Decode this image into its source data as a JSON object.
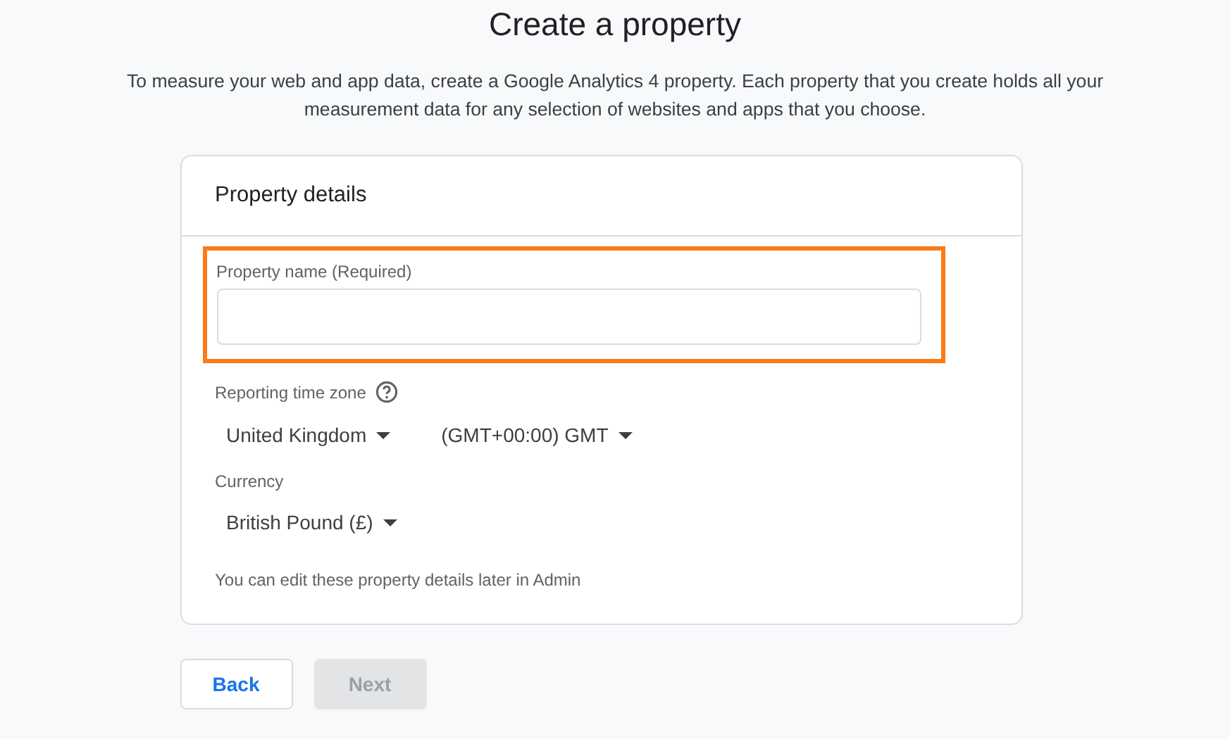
{
  "page_title": "Create a property",
  "intro": "To measure your web and app data, create a Google Analytics 4 property. Each property that you create holds all your measurement data for any selection of websites and apps that you choose.",
  "card": {
    "title": "Property details",
    "property_name": {
      "label": "Property name (Required)",
      "highlighted": true
    },
    "time_zone": {
      "label": "Reporting time zone",
      "dropdowns": [
        "United Kingdom",
        "(GMT+00:00) GMT"
      ]
    },
    "currency": {
      "label": "Currency",
      "dropdowns": [
        "British Pound (£)"
      ]
    },
    "note": "You can edit these property details later in Admin"
  },
  "buttons": [
    {
      "label": "Back",
      "disabled": false
    },
    {
      "label": "Next",
      "disabled": true
    }
  ]
}
